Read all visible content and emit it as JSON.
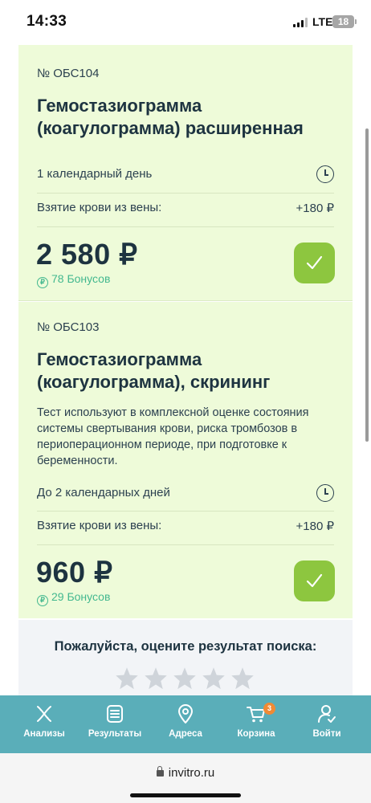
{
  "status_bar": {
    "time": "14:33",
    "network": "LTE",
    "battery": "18"
  },
  "cards": [
    {
      "code": "№ ОБС104",
      "title": "Гемостазиограмма (коагулограмма) расширенная",
      "description": "",
      "duration": "1 календарный день",
      "blood_label": "Взятие крови из вены:",
      "blood_price": "+180 ₽",
      "price": "2 580 ₽",
      "bonus": "78 Бонусов",
      "selected": true
    },
    {
      "code": "№ ОБС103",
      "title": "Гемостазиограмма (коагулограмма), скрининг",
      "description": "Тест используют в комплексной оценке состояния системы свертывания крови, риска тромбозов в периоперационном периоде, при подготовке к беременности.",
      "duration": "До 2 календарных дней",
      "blood_label": "Взятие крови из вены:",
      "blood_price": "+180 ₽",
      "price": "960 ₽",
      "bonus": "29 Бонусов",
      "selected": true
    }
  ],
  "rating": {
    "prompt": "Пожалуйста, оцените результат поиска:",
    "stars": 5,
    "value": 0
  },
  "nav": [
    {
      "label": "Анализы",
      "icon": "dna-icon"
    },
    {
      "label": "Результаты",
      "icon": "results-list-icon"
    },
    {
      "label": "Адреса",
      "icon": "map-pin-icon"
    },
    {
      "label": "Корзина",
      "icon": "cart-icon",
      "badge": "3"
    },
    {
      "label": "Войти",
      "icon": "user-login-icon"
    }
  ],
  "browser": {
    "url": "invitro.ru"
  },
  "colors": {
    "card_bg": "#eefbd9",
    "accent_green": "#8dc63f",
    "bonus_teal": "#43b88f",
    "nav_bg": "#5aaeb9",
    "badge_orange": "#f08a34"
  }
}
